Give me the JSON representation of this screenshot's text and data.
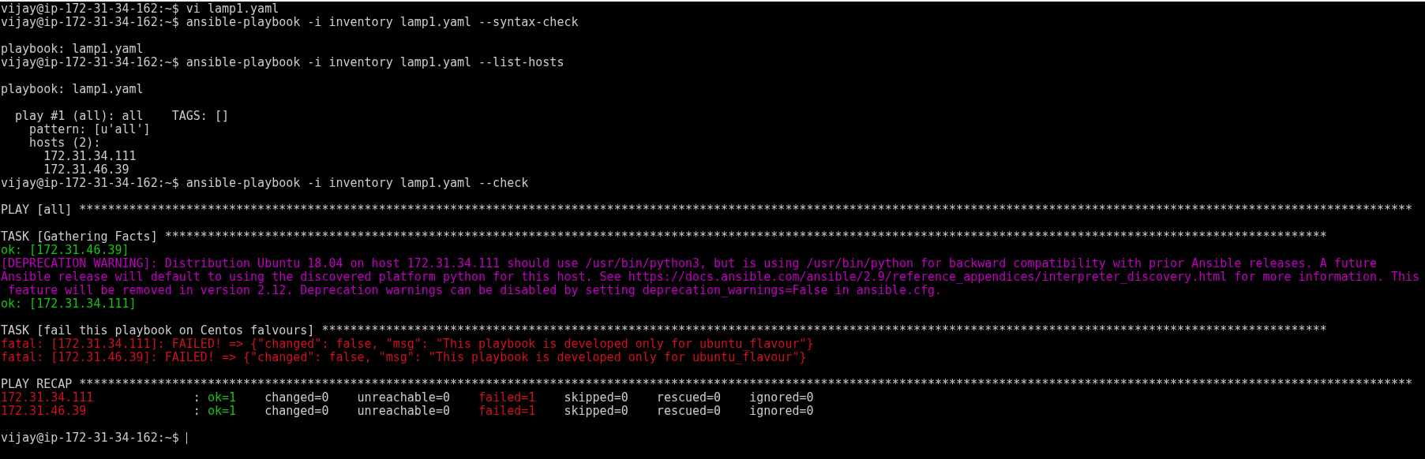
{
  "terminal": {
    "blocks": [
      {
        "lines": [
          [
            {
              "text": "vijay@ip-172-31-34-162:~$ vi lamp1.yaml",
              "color": "#cccccc"
            }
          ],
          [
            {
              "text": "vijay@ip-172-31-34-162:~$ ansible-playbook -i inventory lamp1.yaml --syntax-check",
              "color": "#cccccc"
            }
          ]
        ]
      },
      {
        "lines": [
          [
            {
              "text": "playbook: lamp1.yaml",
              "color": "#cccccc"
            }
          ],
          [
            {
              "text": "vijay@ip-172-31-34-162:~$ ansible-playbook -i inventory lamp1.yaml --list-hosts",
              "color": "#cccccc"
            }
          ]
        ]
      },
      {
        "lines": [
          [
            {
              "text": "playbook: lamp1.yaml",
              "color": "#cccccc"
            }
          ]
        ]
      },
      {
        "lines": [
          [
            {
              "text": "  play #1 (all): all    TAGS: []",
              "color": "#cccccc"
            }
          ],
          [
            {
              "text": "    pattern: [u'all']",
              "color": "#cccccc"
            }
          ],
          [
            {
              "text": "    hosts (2):",
              "color": "#cccccc"
            }
          ],
          [
            {
              "text": "      172.31.34.111",
              "color": "#cccccc"
            }
          ],
          [
            {
              "text": "      172.31.46.39",
              "color": "#cccccc"
            }
          ],
          [
            {
              "text": "vijay@ip-172-31-34-162:~$ ansible-playbook -i inventory lamp1.yaml --check",
              "color": "#cccccc"
            }
          ]
        ]
      },
      {
        "lines": [
          [
            {
              "text": "PLAY [all] *******************************************************************************************************************************************************************************************",
              "color": "#cccccc"
            }
          ]
        ]
      },
      {
        "lines": [
          [
            {
              "text": "TASK [Gathering Facts] *******************************************************************************************************************************************************************",
              "color": "#cccccc"
            }
          ],
          [
            {
              "text": "ok: [172.31.46.39]",
              "color": "#16c60c"
            }
          ],
          [
            {
              "text": "[DEPRECATION WARNING]: Distribution Ubuntu 18.04 on host 172.31.34.111 should use /usr/bin/python3, but is using /usr/bin/python for backward compatibility with prior Ansible releases. A future",
              "color": "#c000c0"
            }
          ],
          [
            {
              "text": "Ansible release will default to using the discovered platform python for this host. See https://docs.ansible.com/ansible/2.9/reference_appendices/interpreter_discovery.html for more information. This",
              "color": "#c000c0"
            }
          ],
          [
            {
              "text": " feature will be removed in version 2.12. Deprecation warnings can be disabled by setting deprecation_warnings=False in ansible.cfg.",
              "color": "#c000c0"
            }
          ],
          [
            {
              "text": "ok: [172.31.34.111]",
              "color": "#16c60c"
            }
          ]
        ]
      },
      {
        "lines": [
          [
            {
              "text": "TASK [fail this playbook on Centos falvours] *********************************************************************************************************************************************",
              "color": "#cccccc"
            }
          ],
          [
            {
              "text": "fatal: [172.31.34.111]: FAILED! => {\"changed\": false, \"msg\": \"This playbook is developed only for ubuntu_flavour\"}",
              "color": "#d01020"
            }
          ],
          [
            {
              "text": "fatal: [172.31.46.39]: FAILED! => {\"changed\": false, \"msg\": \"This playbook is developed only for ubuntu_flavour\"}",
              "color": "#d01020"
            }
          ]
        ]
      },
      {
        "lines": [
          [
            {
              "text": "PLAY RECAP *******************************************************************************************************************************************************************************************",
              "color": "#cccccc"
            }
          ],
          [
            {
              "text": "172.31.34.111",
              "color": "#d01020"
            },
            {
              "text": "              : ",
              "color": "#cccccc"
            },
            {
              "text": "ok=1",
              "color": "#16c60c"
            },
            {
              "text": "    changed=0    unreachable=0    ",
              "color": "#cccccc"
            },
            {
              "text": "failed=1",
              "color": "#d01020"
            },
            {
              "text": "    skipped=0    rescued=0    ignored=0",
              "color": "#cccccc"
            }
          ],
          [
            {
              "text": "172.31.46.39",
              "color": "#d01020"
            },
            {
              "text": "               : ",
              "color": "#cccccc"
            },
            {
              "text": "ok=1",
              "color": "#16c60c"
            },
            {
              "text": "    changed=0    unreachable=0    ",
              "color": "#cccccc"
            },
            {
              "text": "failed=1",
              "color": "#d01020"
            },
            {
              "text": "    skipped=0    rescued=0    ignored=0",
              "color": "#cccccc"
            }
          ]
        ]
      }
    ],
    "prompt": {
      "text": "vijay@ip-172-31-34-162:~$ ",
      "cursor": true
    }
  }
}
